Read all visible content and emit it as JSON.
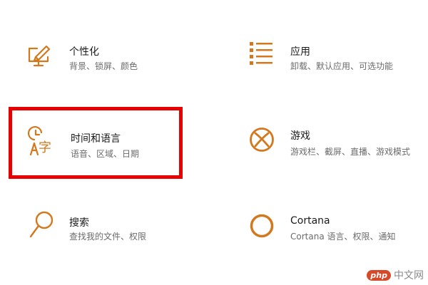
{
  "accent_color": "#d4781e",
  "highlight_color": "#e60000",
  "tiles": [
    {
      "key": "personalization",
      "title": "个性化",
      "desc": "背景、锁屏、颜色",
      "icon": "personalization-icon"
    },
    {
      "key": "apps",
      "title": "应用",
      "desc": "卸载、默认应用、可选功能",
      "icon": "apps-list-icon"
    },
    {
      "key": "time_language",
      "title": "时间和语言",
      "desc": "语音、区域、日期",
      "icon": "time-language-icon",
      "highlighted": true
    },
    {
      "key": "gaming",
      "title": "游戏",
      "desc": "游戏栏、截屏、直播、游戏模式",
      "icon": "xbox-icon"
    },
    {
      "key": "search",
      "title": "搜索",
      "desc": "查找我的文件、权限",
      "icon": "search-icon"
    },
    {
      "key": "cortana",
      "title": "Cortana",
      "desc": "Cortana 语言、权限、通知",
      "icon": "cortana-icon"
    }
  ],
  "watermark": {
    "logo": "php",
    "text": "中文网"
  }
}
